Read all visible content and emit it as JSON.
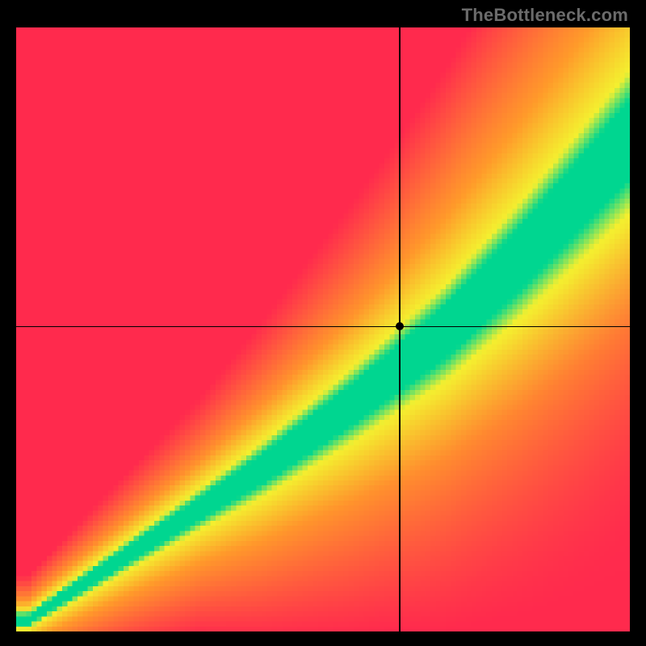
{
  "attribution": "TheBottleneck.com",
  "chart_data": {
    "type": "heatmap",
    "title": "",
    "xlabel": "",
    "ylabel": "",
    "xlim": [
      0,
      1
    ],
    "ylim": [
      0,
      1
    ],
    "grid": false,
    "legend": false,
    "crosshair": {
      "x": 0.625,
      "y": 0.505
    },
    "marker": {
      "x": 0.625,
      "y": 0.505
    },
    "diagonal_band": {
      "description": "Green optimal band along a curved diagonal; yellow transition; red/orange far from diagonal",
      "curve_points_xy": [
        [
          0.02,
          0.02
        ],
        [
          0.2,
          0.14
        ],
        [
          0.4,
          0.27
        ],
        [
          0.55,
          0.38
        ],
        [
          0.7,
          0.5
        ],
        [
          0.82,
          0.62
        ],
        [
          0.92,
          0.73
        ],
        [
          1.0,
          0.82
        ]
      ],
      "green_halfwidth_at_x": [
        [
          0.02,
          0.008
        ],
        [
          0.3,
          0.02
        ],
        [
          0.6,
          0.04
        ],
        [
          0.8,
          0.055
        ],
        [
          1.0,
          0.07
        ]
      ]
    },
    "color_stops": {
      "green": "#00d690",
      "yellow": "#f4ef2f",
      "orange": "#ff9a2a",
      "red": "#ff2a4d"
    },
    "resolution": {
      "cols": 120,
      "rows": 120
    }
  }
}
